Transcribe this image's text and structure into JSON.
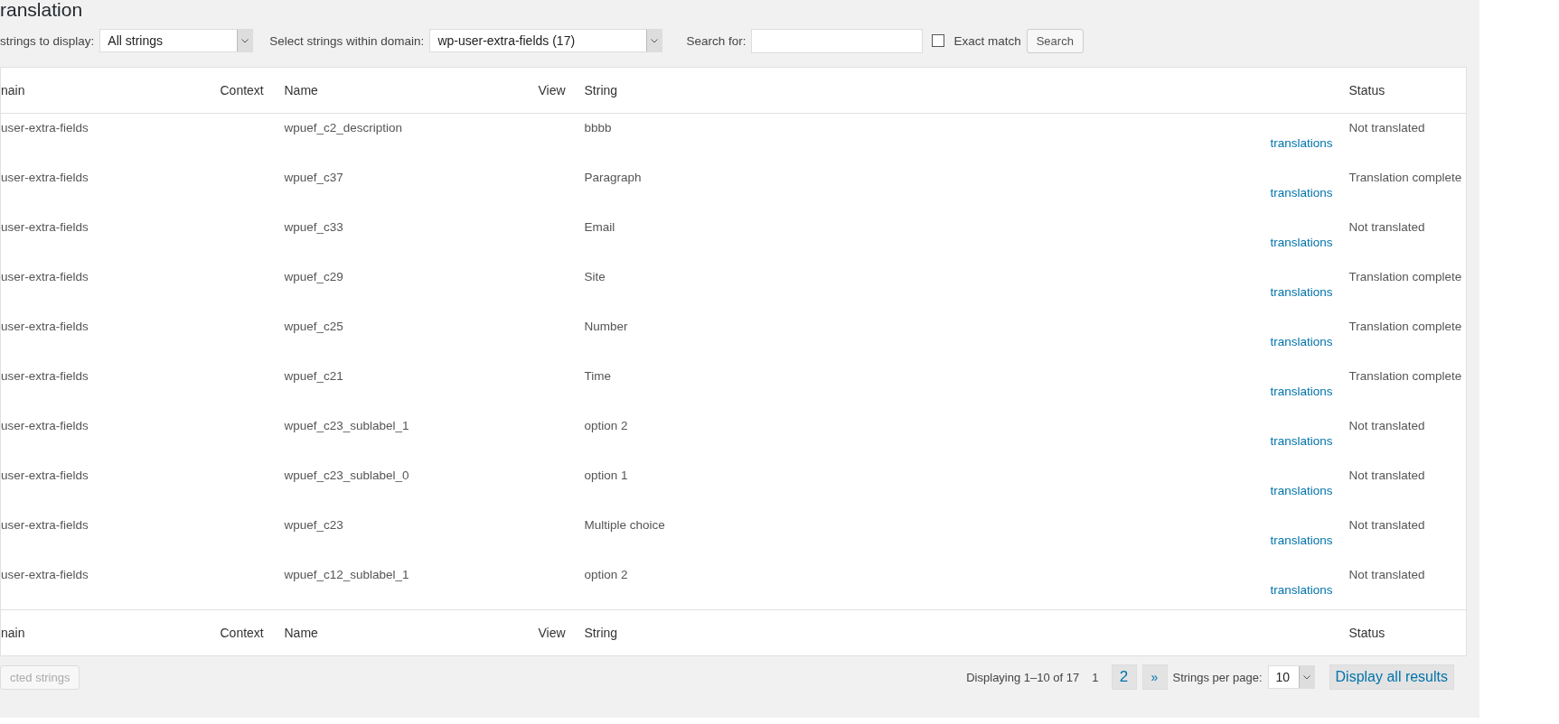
{
  "page_title": "ranslation",
  "filters": {
    "display_label": "strings to display:",
    "display_value": "All strings",
    "domain_label": "Select strings within domain:",
    "domain_value": "wp-user-extra-fields (17)",
    "search_label": "Search for:",
    "exact_match_label": "Exact match",
    "exact_match_checked": false,
    "search_button": "Search"
  },
  "table": {
    "columns": [
      "nain",
      "Context",
      "Name",
      "View",
      "String",
      "Status"
    ],
    "rows": [
      {
        "domain": "user-extra-fields",
        "name": "wpuef_c2_description",
        "string": "bbbb",
        "link": "translations",
        "status": "Not translated"
      },
      {
        "domain": "user-extra-fields",
        "name": "wpuef_c37",
        "string": "Paragraph",
        "link": "translations",
        "status": "Translation complete"
      },
      {
        "domain": "user-extra-fields",
        "name": "wpuef_c33",
        "string": "Email",
        "link": "translations",
        "status": "Not translated"
      },
      {
        "domain": "user-extra-fields",
        "name": "wpuef_c29",
        "string": "Site",
        "link": "translations",
        "status": "Translation complete"
      },
      {
        "domain": "user-extra-fields",
        "name": "wpuef_c25",
        "string": "Number",
        "link": "translations",
        "status": "Translation complete"
      },
      {
        "domain": "user-extra-fields",
        "name": "wpuef_c21",
        "string": "Time",
        "link": "translations",
        "status": "Translation complete"
      },
      {
        "domain": "user-extra-fields",
        "name": "wpuef_c23_sublabel_1",
        "string": "option 2",
        "link": "translations",
        "status": "Not translated"
      },
      {
        "domain": "user-extra-fields",
        "name": "wpuef_c23_sublabel_0",
        "string": "option 1",
        "link": "translations",
        "status": "Not translated"
      },
      {
        "domain": "user-extra-fields",
        "name": "wpuef_c23",
        "string": "Multiple choice",
        "link": "translations",
        "status": "Not translated"
      },
      {
        "domain": "user-extra-fields",
        "name": "wpuef_c12_sublabel_1",
        "string": "option 2",
        "link": "translations",
        "status": "Not translated"
      }
    ],
    "footer_columns": [
      "nain",
      "Context",
      "Name",
      "View",
      "String",
      "Status"
    ]
  },
  "bottom": {
    "bulk_button": "cted strings",
    "bulk_disabled": true,
    "displaying": "Displaying 1–10 of 17",
    "pages": [
      {
        "label": "1",
        "selected": true
      },
      {
        "label": "2",
        "selected": false
      },
      {
        "label": "»",
        "selected": false
      }
    ],
    "per_page_label": "Strings per page:",
    "per_page_value": "10",
    "display_all": "Display all results"
  }
}
